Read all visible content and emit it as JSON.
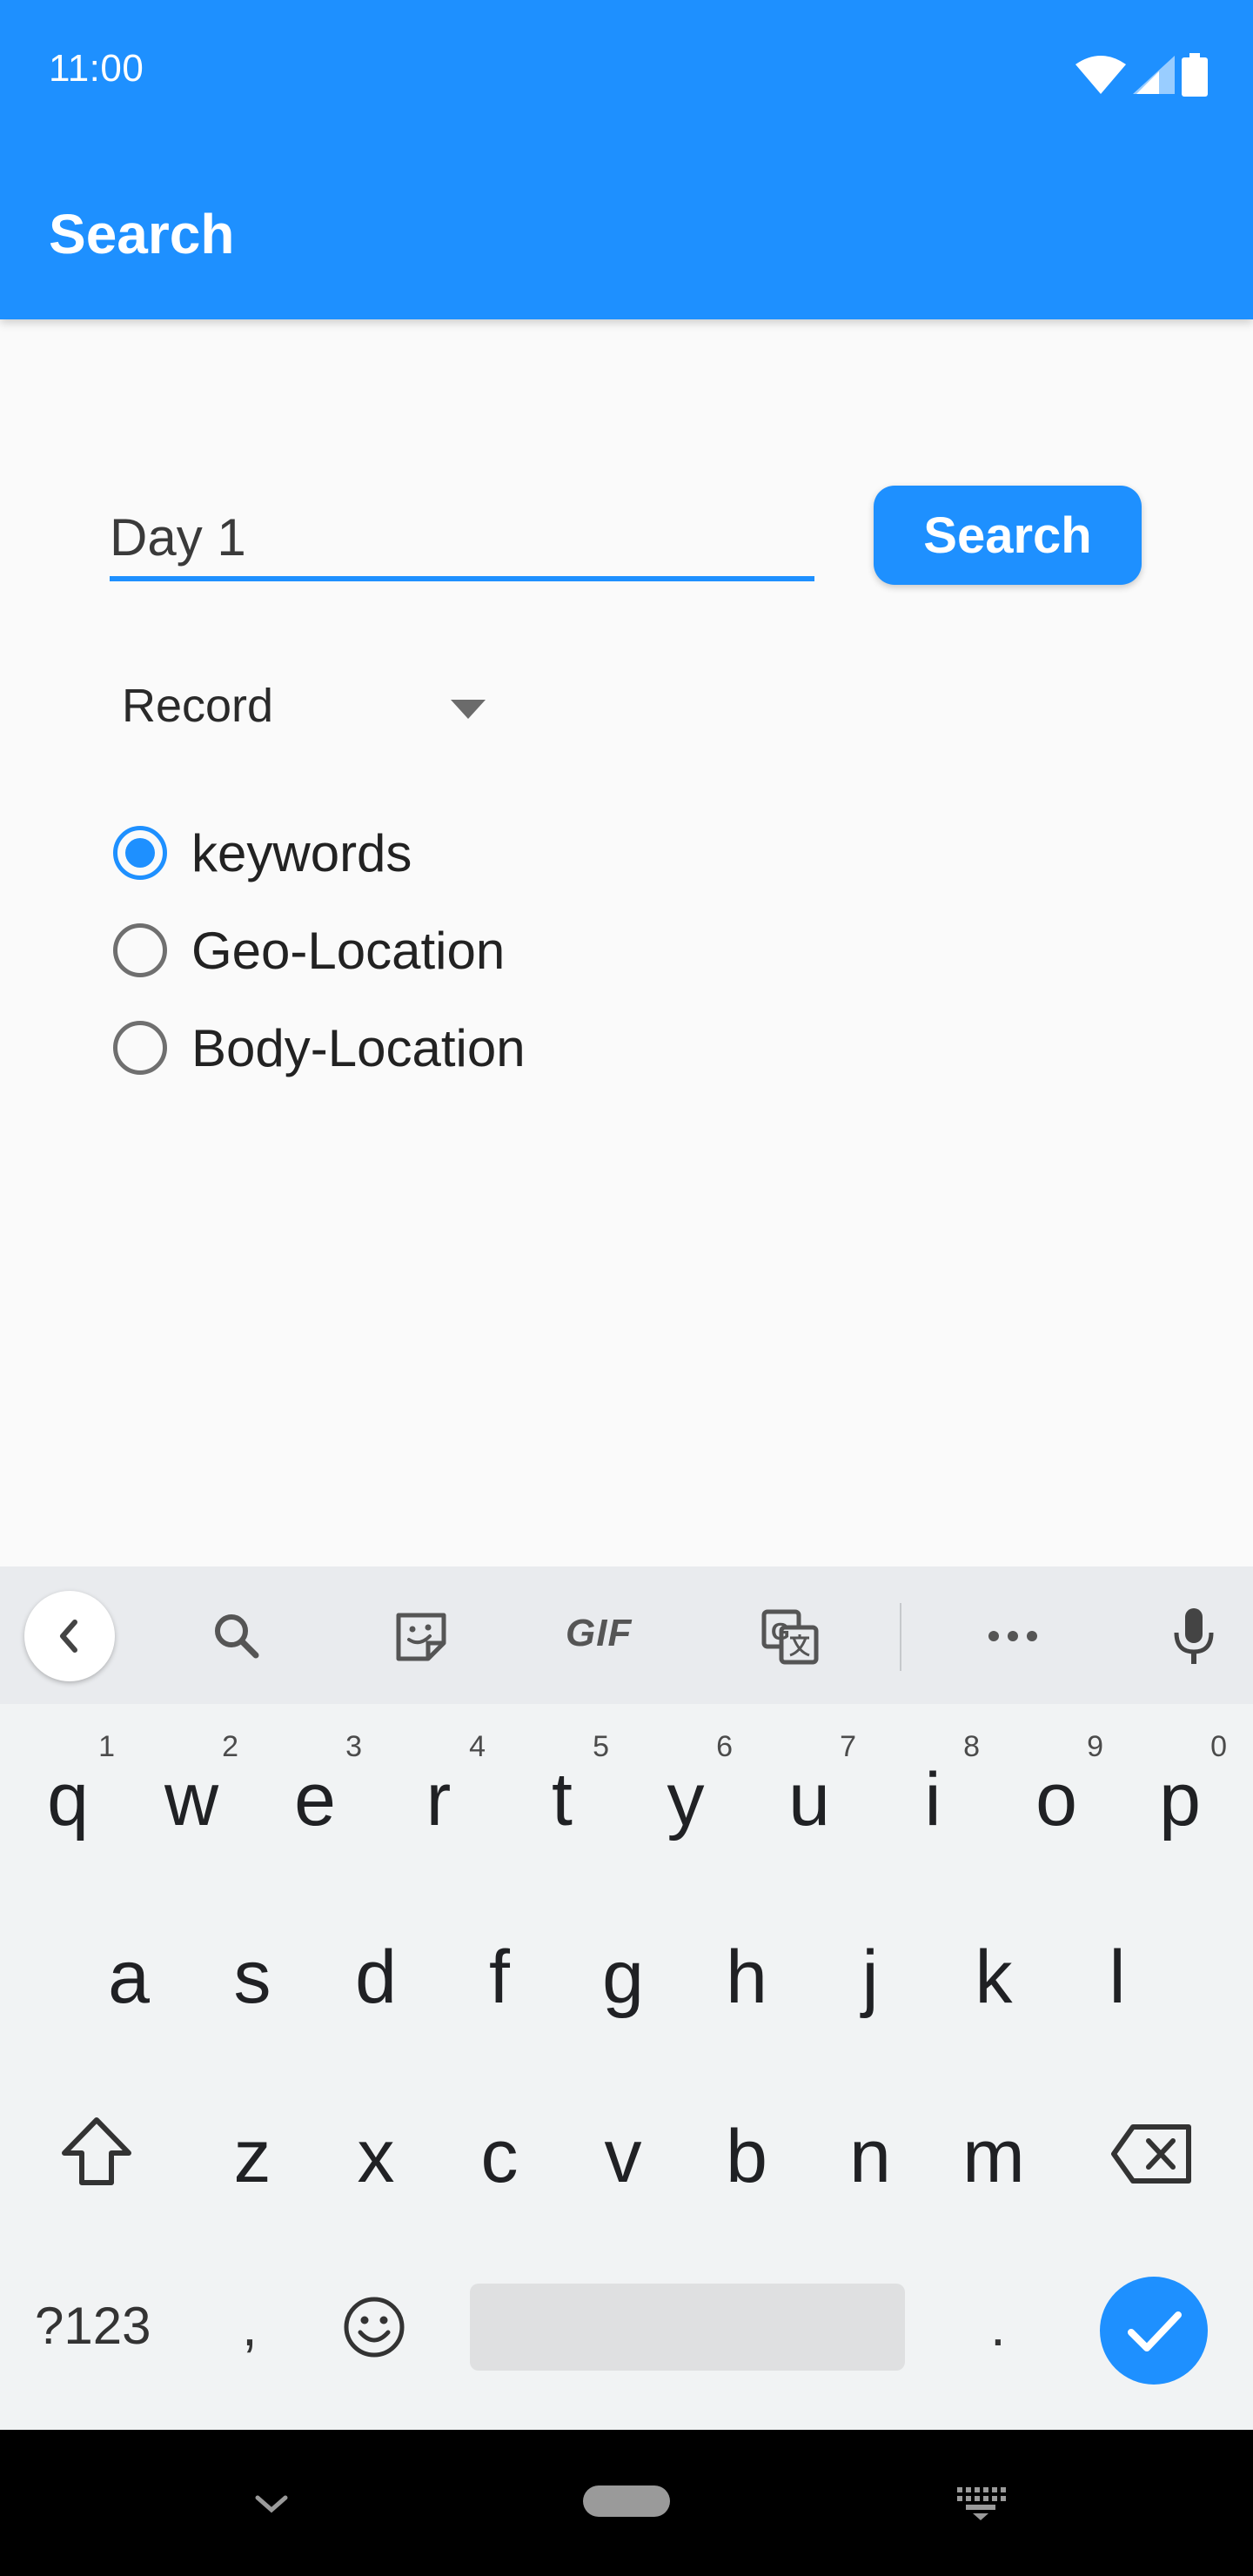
{
  "status_bar": {
    "time": "11:00",
    "icons": [
      "wifi-icon",
      "signal-icon",
      "battery-icon"
    ]
  },
  "app_bar": {
    "title": "Search",
    "background": "#1e90ff"
  },
  "search": {
    "value": "Day 1",
    "button_label": "Search"
  },
  "dropdown": {
    "selected": "Record"
  },
  "radio_options": [
    {
      "label": "keywords",
      "checked": true
    },
    {
      "label": "Geo-Location",
      "checked": false
    },
    {
      "label": "Body-Location",
      "checked": false
    }
  ],
  "keyboard": {
    "toolbar_icons": [
      "back-chevron-icon",
      "search-icon",
      "sticker-icon",
      "gif-icon",
      "translate-icon",
      "more-icon",
      "mic-icon"
    ],
    "gif_label": "GIF",
    "row1": [
      {
        "key": "q",
        "hint": "1"
      },
      {
        "key": "w",
        "hint": "2"
      },
      {
        "key": "e",
        "hint": "3"
      },
      {
        "key": "r",
        "hint": "4"
      },
      {
        "key": "t",
        "hint": "5"
      },
      {
        "key": "y",
        "hint": "6"
      },
      {
        "key": "u",
        "hint": "7"
      },
      {
        "key": "i",
        "hint": "8"
      },
      {
        "key": "o",
        "hint": "9"
      },
      {
        "key": "p",
        "hint": "0"
      }
    ],
    "row2": [
      "a",
      "s",
      "d",
      "f",
      "g",
      "h",
      "j",
      "k",
      "l"
    ],
    "row3": [
      "z",
      "x",
      "c",
      "v",
      "b",
      "n",
      "m"
    ],
    "symbols_label": "?123",
    "comma": ",",
    "period": "."
  },
  "colors": {
    "accent": "#1e90ff",
    "background": "#fafafa",
    "keyboard": "#f1f3f4"
  }
}
